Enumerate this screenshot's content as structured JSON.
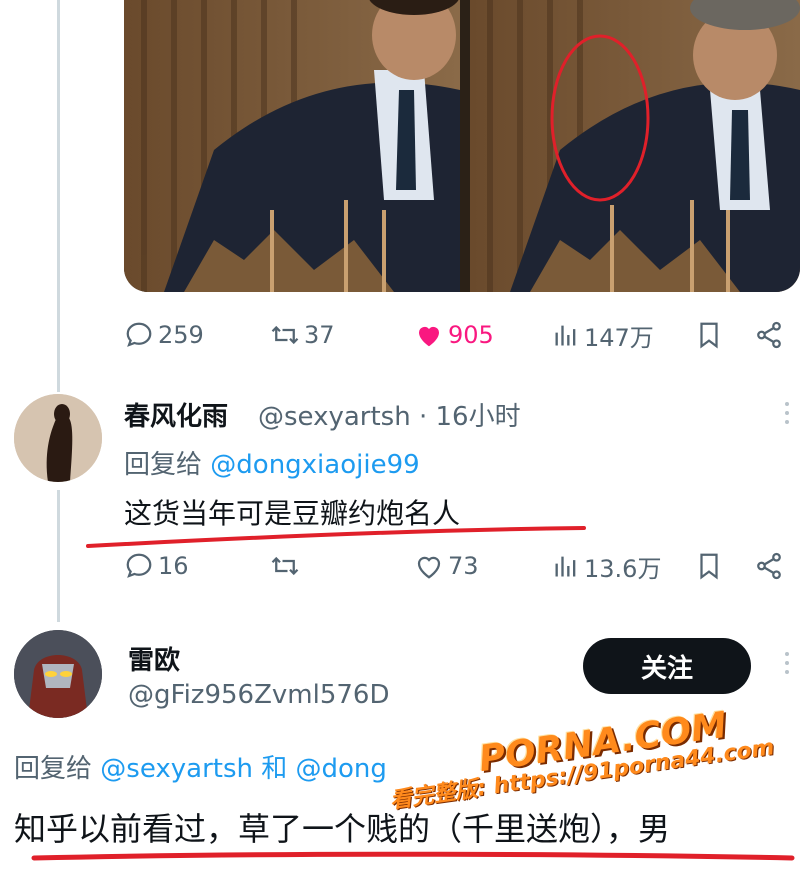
{
  "tweet_stats": {
    "replies": "259",
    "retweets": "37",
    "likes": "905",
    "views": "147万",
    "like_color": "#f91880"
  },
  "reply1": {
    "name": "春风化雨",
    "handle": "@sexyartsh · 16小时",
    "reply_prefix": "回复给",
    "reply_mention": "@dongxiaojie99",
    "text": "这货当年可是豆瓣约炮名人",
    "stats": {
      "replies": "16",
      "retweets": "",
      "likes": "73",
      "views": "13.6万"
    }
  },
  "reply2": {
    "name": "雷欧",
    "handle": "@gFiz956Zvml576D",
    "follow_label": "关注",
    "reply_prefix": "回复给",
    "reply_mentions": "@sexyartsh 和 @dong",
    "text": "知乎以前看过，草了一个贱的（千里送炮），男"
  },
  "watermark": {
    "logo": "PORNA.COM",
    "site": "看完整版: https://91porna44.com"
  },
  "colors": {
    "accent": "#1d9bf0",
    "text_secondary": "#536471",
    "annotation_red": "#e0202a"
  },
  "icons": [
    "reply-icon",
    "retweet-icon",
    "heart-icon",
    "views-icon",
    "bookmark-icon",
    "share-icon",
    "more-icon"
  ]
}
